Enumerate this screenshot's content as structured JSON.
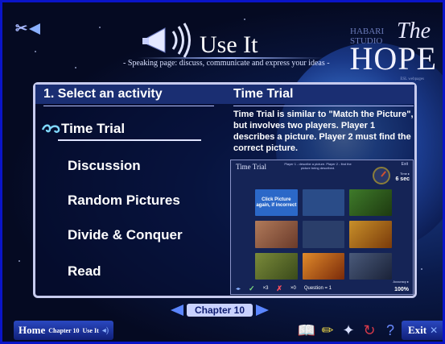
{
  "page": {
    "title": "Use It",
    "subtitle": "- Speaking page: discuss, communicate and express your ideas -"
  },
  "logo": {
    "the": "The",
    "hope": "HOPE",
    "bg_text": "HABARI\nSTUDIO",
    "foot": "ESL webpages"
  },
  "activities": {
    "heading": "1.  Select an activity",
    "items": [
      "Time Trial",
      "Discussion",
      "Random Pictures",
      "Divide & Conquer",
      "Read"
    ],
    "selected": "Time Trial"
  },
  "detail": {
    "heading": "Time Trial",
    "description": "Time Trial is similar to \"Match the Picture\", but involves two players. Player 1 describes a picture. Player 2 must find the correct picture."
  },
  "preview": {
    "title": "Time Trial",
    "instructions": "Player 1 - describe a picture. Player 2 - find the picture being described.",
    "exit": "Exit",
    "time_label": "Time ▸",
    "time_value": "6 sec",
    "tip": "Click Picture again, if incorrect",
    "correct": "×3",
    "wrong": "×0",
    "question": "Question = 1",
    "accuracy_label": "Accuracy ▸",
    "accuracy_value": "100%"
  },
  "chapter": {
    "label": "Chapter 10"
  },
  "bottom": {
    "home": "Home",
    "crumb_chapter": "Chapter 10",
    "crumb_use": "Use It",
    "exit": "Exit"
  },
  "icons": {
    "tool": "tools-icon",
    "book": "book-icon",
    "pencil": "pencil-icon",
    "compass": "compass-icon",
    "refresh": "refresh-icon",
    "help": "help-icon"
  },
  "colors": {
    "frame_blue": "#0a14c8",
    "accent_blue": "#5b86ff",
    "header_blue": "#1a2e72"
  }
}
